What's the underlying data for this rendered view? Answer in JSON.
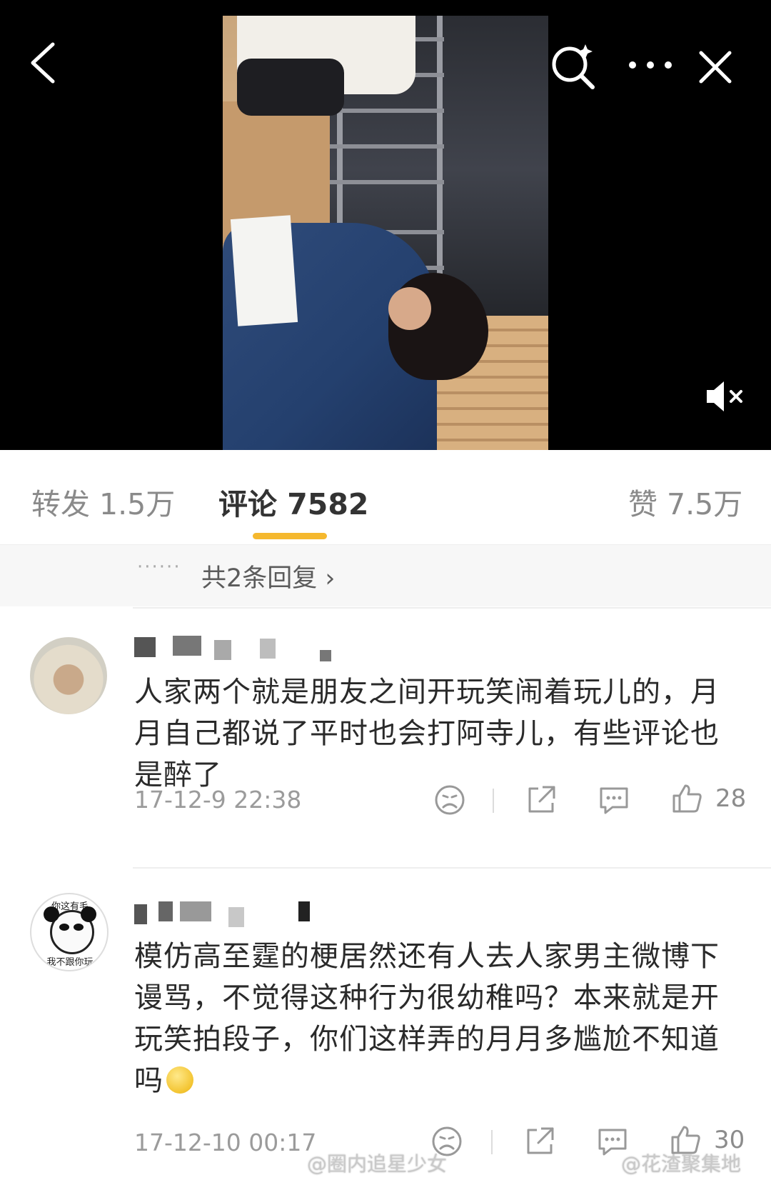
{
  "header": {
    "back_icon": "chevron-left-icon",
    "search_icon": "search-icon",
    "more_icon": "more-dots-icon",
    "close_icon": "close-icon",
    "mute_icon": "speaker-muted-icon"
  },
  "tabs": [
    {
      "label": "转发 1.5万"
    },
    {
      "label": "评论 7582"
    },
    {
      "label": "赞 7.5万"
    }
  ],
  "colors": {
    "accent": "#f5b82e",
    "text_muted": "#8a8a8a",
    "text_main": "#2a2a2a"
  },
  "replies": {
    "dots": "······",
    "link": "共2条回复 ›"
  },
  "comments": [
    {
      "text": "人家两个就是朋友之间开玩笑闹着玩儿的，月月自己都说了平时也会打阿寺儿，有些评论也是醉了",
      "time": "17-12-9 22:38",
      "likes": "28"
    },
    {
      "avatar_caption_top": "你这有毛",
      "avatar_caption_bottom": "我不跟你玩",
      "text": "模仿高至霆的梗居然还有人去人家男主微博下谩骂，不觉得这种行为很幼稚吗？本来就是开玩笑拍段子，你们这样弄的月月多尴尬不知道吗",
      "time": "17-12-10 00:17",
      "likes": "30"
    }
  ],
  "watermarks": [
    {
      "text": "@圈内追星少女"
    },
    {
      "text": "@花渣聚集地"
    }
  ]
}
